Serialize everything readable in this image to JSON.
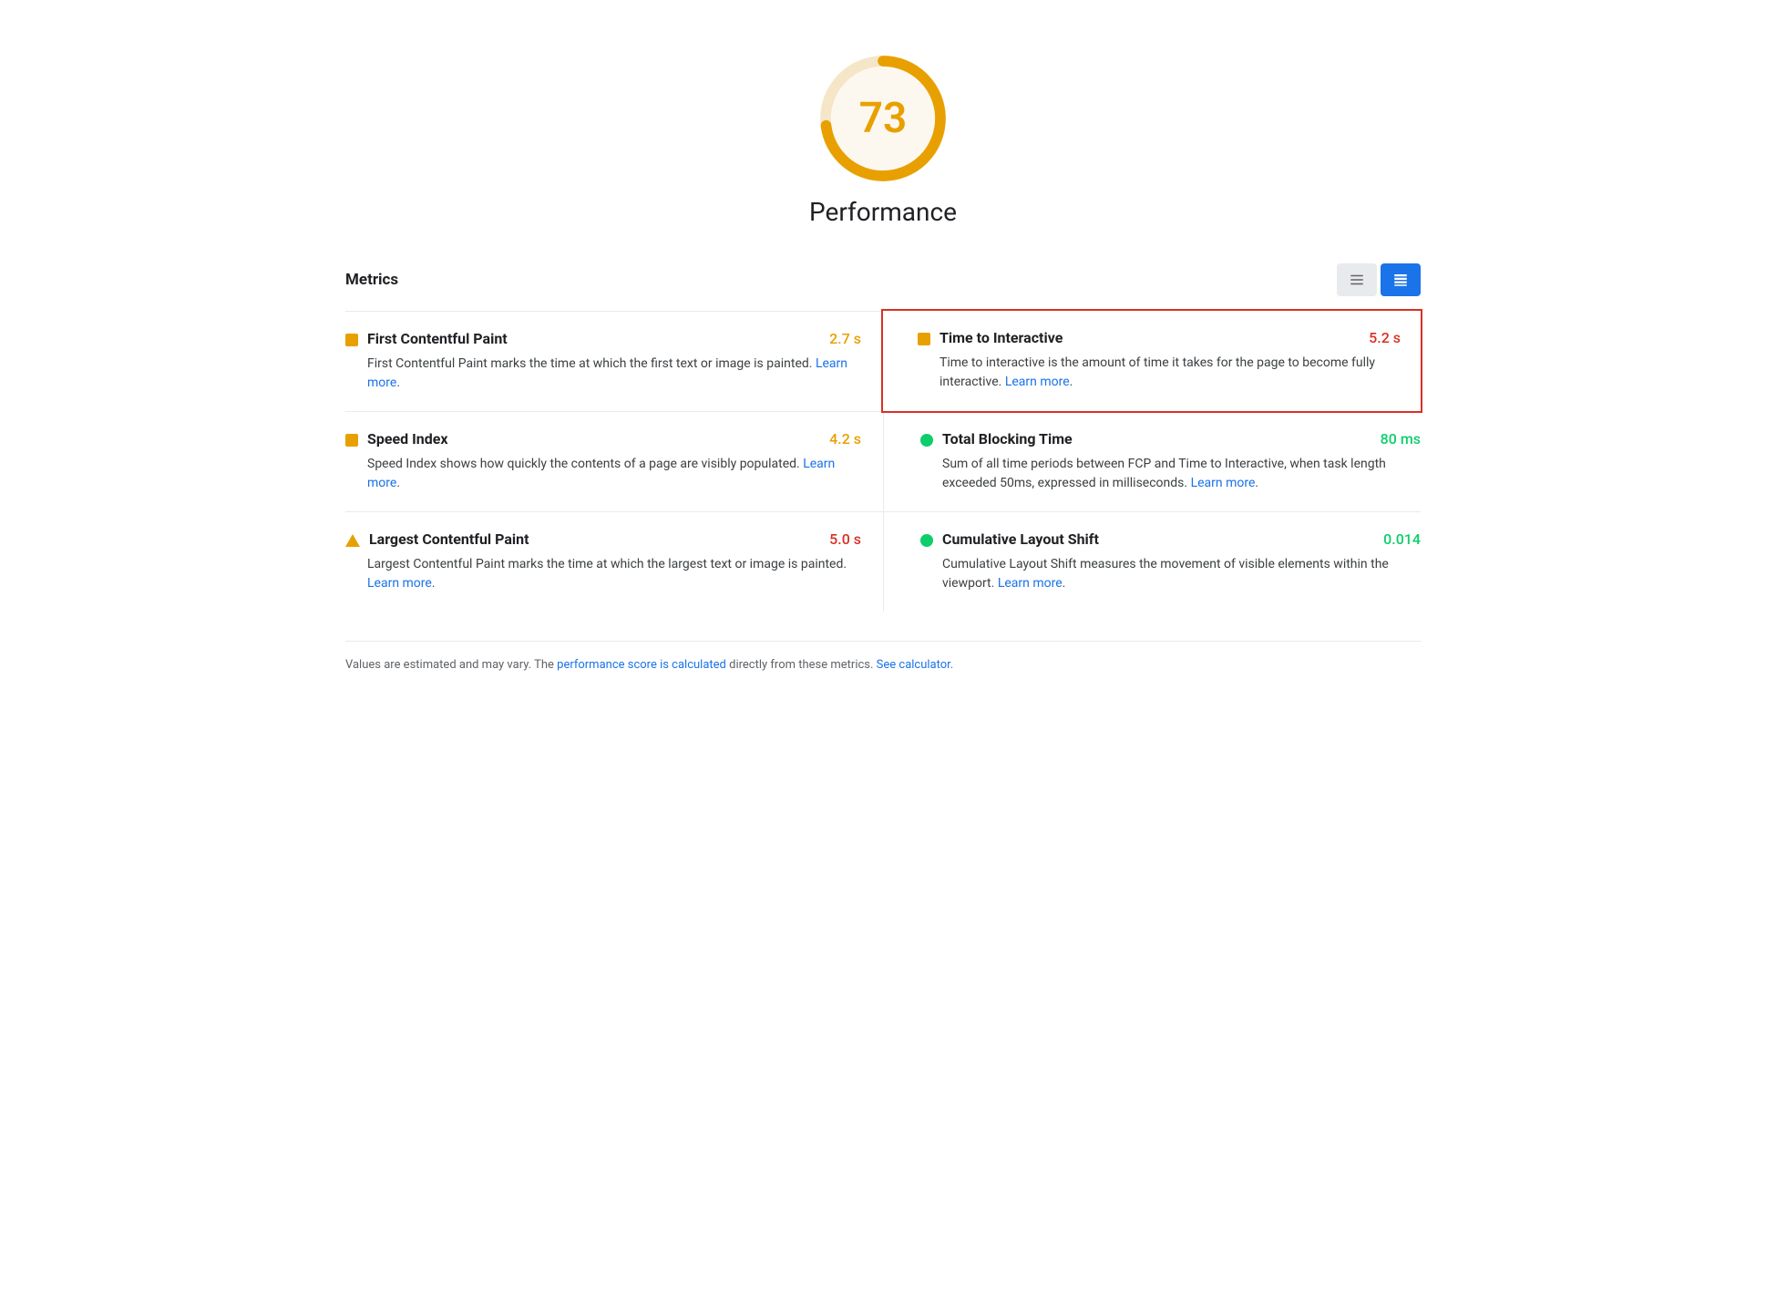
{
  "score": {
    "value": "73",
    "color": "#e8a000",
    "bg_color": "#fdf8ef"
  },
  "title": "Performance",
  "metrics_label": "Metrics",
  "toolbar": {
    "list_icon_label": "list-view",
    "detail_icon_label": "detail-view"
  },
  "metrics": [
    {
      "id": "fcp",
      "name": "First Contentful Paint",
      "description": "First Contentful Paint marks the time at which the first text or image is painted.",
      "value": "2.7 s",
      "value_color": "orange",
      "icon_type": "orange-square",
      "link_text": "Learn more",
      "link_href": "#",
      "highlighted": false,
      "side": "left"
    },
    {
      "id": "tti",
      "name": "Time to Interactive",
      "description": "Time to interactive is the amount of time it takes for the page to become fully interactive.",
      "value": "5.2 s",
      "value_color": "red",
      "icon_type": "orange-square",
      "link_text": "Learn more",
      "link_href": "#",
      "highlighted": true,
      "side": "right"
    },
    {
      "id": "si",
      "name": "Speed Index",
      "description": "Speed Index shows how quickly the contents of a page are visibly populated.",
      "value": "4.2 s",
      "value_color": "orange",
      "icon_type": "orange-square",
      "link_text": "Learn more",
      "link_href": "#",
      "highlighted": false,
      "side": "left"
    },
    {
      "id": "tbt",
      "name": "Total Blocking Time",
      "description": "Sum of all time periods between FCP and Time to Interactive, when task length exceeded 50ms, expressed in milliseconds.",
      "value": "80 ms",
      "value_color": "green",
      "icon_type": "green-circle",
      "link_text": "Learn more",
      "link_href": "#",
      "highlighted": false,
      "side": "right"
    },
    {
      "id": "lcp",
      "name": "Largest Contentful Paint",
      "description": "Largest Contentful Paint marks the time at which the largest text or image is painted.",
      "value": "5.0 s",
      "value_color": "red",
      "icon_type": "orange-triangle",
      "link_text": "Learn more",
      "link_href": "#",
      "highlighted": false,
      "side": "left"
    },
    {
      "id": "cls",
      "name": "Cumulative Layout Shift",
      "description": "Cumulative Layout Shift measures the movement of visible elements within the viewport.",
      "value": "0.014",
      "value_color": "green",
      "icon_type": "green-circle",
      "link_text": "Learn more",
      "link_href": "#",
      "highlighted": false,
      "side": "right"
    }
  ],
  "footer": {
    "prefix": "Values are estimated and may vary. The ",
    "link1_text": "performance score is calculated",
    "link1_href": "#",
    "middle": " directly from these metrics. ",
    "link2_text": "See calculator.",
    "link2_href": "#"
  }
}
